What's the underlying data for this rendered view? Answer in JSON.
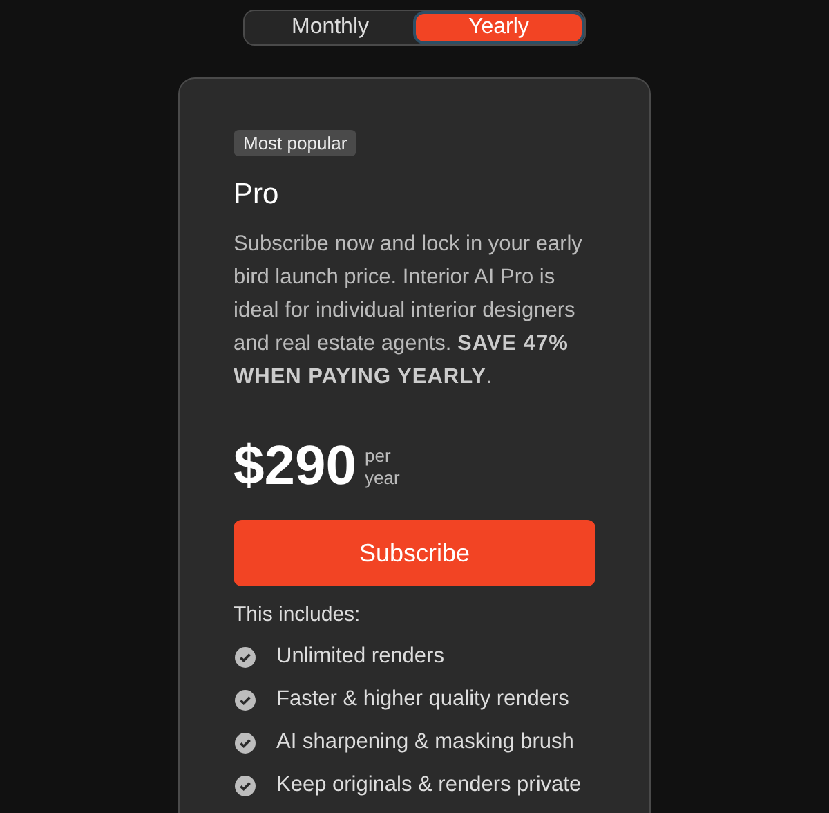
{
  "billing_toggle": [
    {
      "label": "Monthly",
      "selected": false
    },
    {
      "label": "Yearly",
      "selected": true
    }
  ],
  "plan": {
    "badge": "Most popular",
    "name": "Pro",
    "description": "Subscribe now and lock in your early bird launch price. Interior AI Pro is ideal for individual interior designers and real estate agents. **SAVE 47% WHEN PAYING YEARLY**.",
    "price": "$290",
    "period": "per year",
    "button": "Subscribe",
    "includes_heading": "This includes:",
    "features": [
      "Unlimited renders",
      "Faster & higher quality renders",
      "AI sharpening & masking brush",
      "Keep originals & renders private"
    ]
  }
}
